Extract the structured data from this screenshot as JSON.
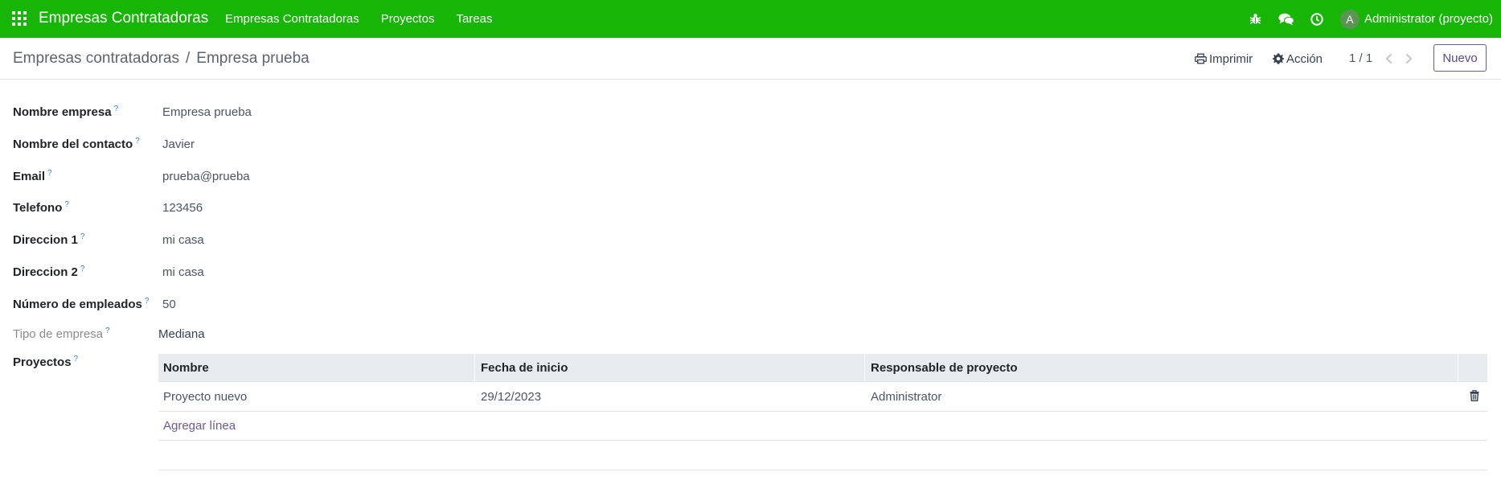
{
  "navbar": {
    "brand": "Empresas Contratadoras",
    "menu": [
      {
        "label": "Empresas Contratadoras"
      },
      {
        "label": "Proyectos"
      },
      {
        "label": "Tareas"
      }
    ],
    "icons": [
      "bug-icon",
      "chat-icon",
      "clock-icon"
    ],
    "avatar_initial": "A",
    "user": "Administrator (proyecto)",
    "color": "#16b506"
  },
  "control_panel": {
    "breadcrumb_parent": "Empresas contratadoras",
    "breadcrumb_separator": "/",
    "breadcrumb_current": "Empresa prueba",
    "print_label": "Imprimir",
    "action_label": "Acción",
    "pager": "1 / 1",
    "new_label": "Nuevo"
  },
  "form": {
    "fields": [
      {
        "label": "Nombre empresa",
        "help": "?",
        "value": "Empresa prueba"
      },
      {
        "label": "Nombre del contacto",
        "help": "?",
        "value": "Javier"
      },
      {
        "label": "Email",
        "help": "?",
        "value": "prueba@prueba"
      },
      {
        "label": "Telefono",
        "help": "?",
        "value": "123456"
      },
      {
        "label": "Direccion 1",
        "help": "?",
        "value": "mi casa"
      },
      {
        "label": "Direccion 2",
        "help": "?",
        "value": "mi casa"
      },
      {
        "label": "Número de empleados",
        "help": "?",
        "value": "50"
      }
    ],
    "tipo_empresa": {
      "label": "Tipo de empresa",
      "help": "?",
      "value": "Mediana"
    },
    "proyectos": {
      "label": "Proyectos",
      "help": "?",
      "columns": [
        "Nombre",
        "Fecha de inicio",
        "Responsable de proyecto"
      ],
      "rows": [
        {
          "nombre": "Proyecto nuevo",
          "fecha": "29/12/2023",
          "responsable": "Administrator"
        }
      ],
      "add_line": "Agregar línea"
    }
  }
}
